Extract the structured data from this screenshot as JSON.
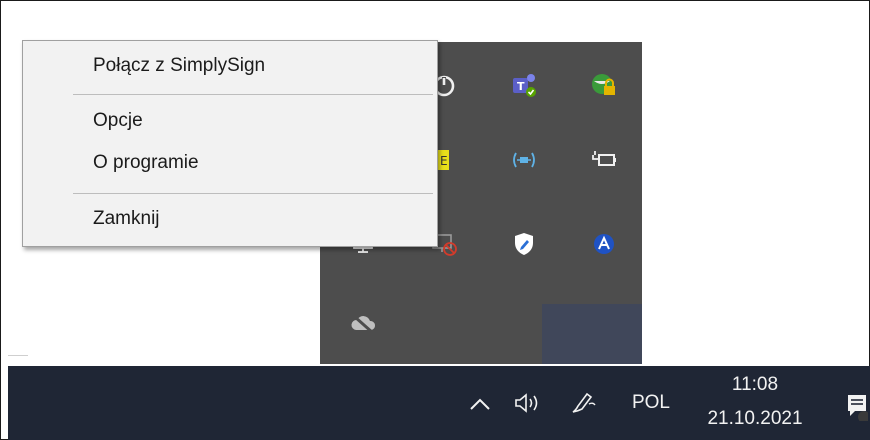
{
  "context_menu": {
    "items": [
      {
        "label": "Połącz z SimplySign"
      },
      {
        "label": "Opcje"
      },
      {
        "label": "O programie"
      },
      {
        "label": "Zamknij"
      }
    ]
  },
  "tray_flyout": {
    "icons": [
      "power-icon",
      "teams-icon",
      "vpn-lock-icon",
      "yellow-app-icon",
      "bluetooth-broadcast-icon",
      "battery-plug-icon",
      "monitor-icon",
      "network-disconnected-icon",
      "security-shield-icon",
      "blue-a-icon",
      "cloud-offline-icon"
    ]
  },
  "taskbar": {
    "language": "POL",
    "time": "11:08",
    "date": "21.10.2021",
    "icons": [
      "chevron-up-icon",
      "volume-icon",
      "pen-icon",
      "notification-icon"
    ]
  },
  "colors": {
    "taskbar_bg": "#1f2635",
    "flyout_bg": "#4d4d4d",
    "menu_bg": "#f2f2f2"
  }
}
